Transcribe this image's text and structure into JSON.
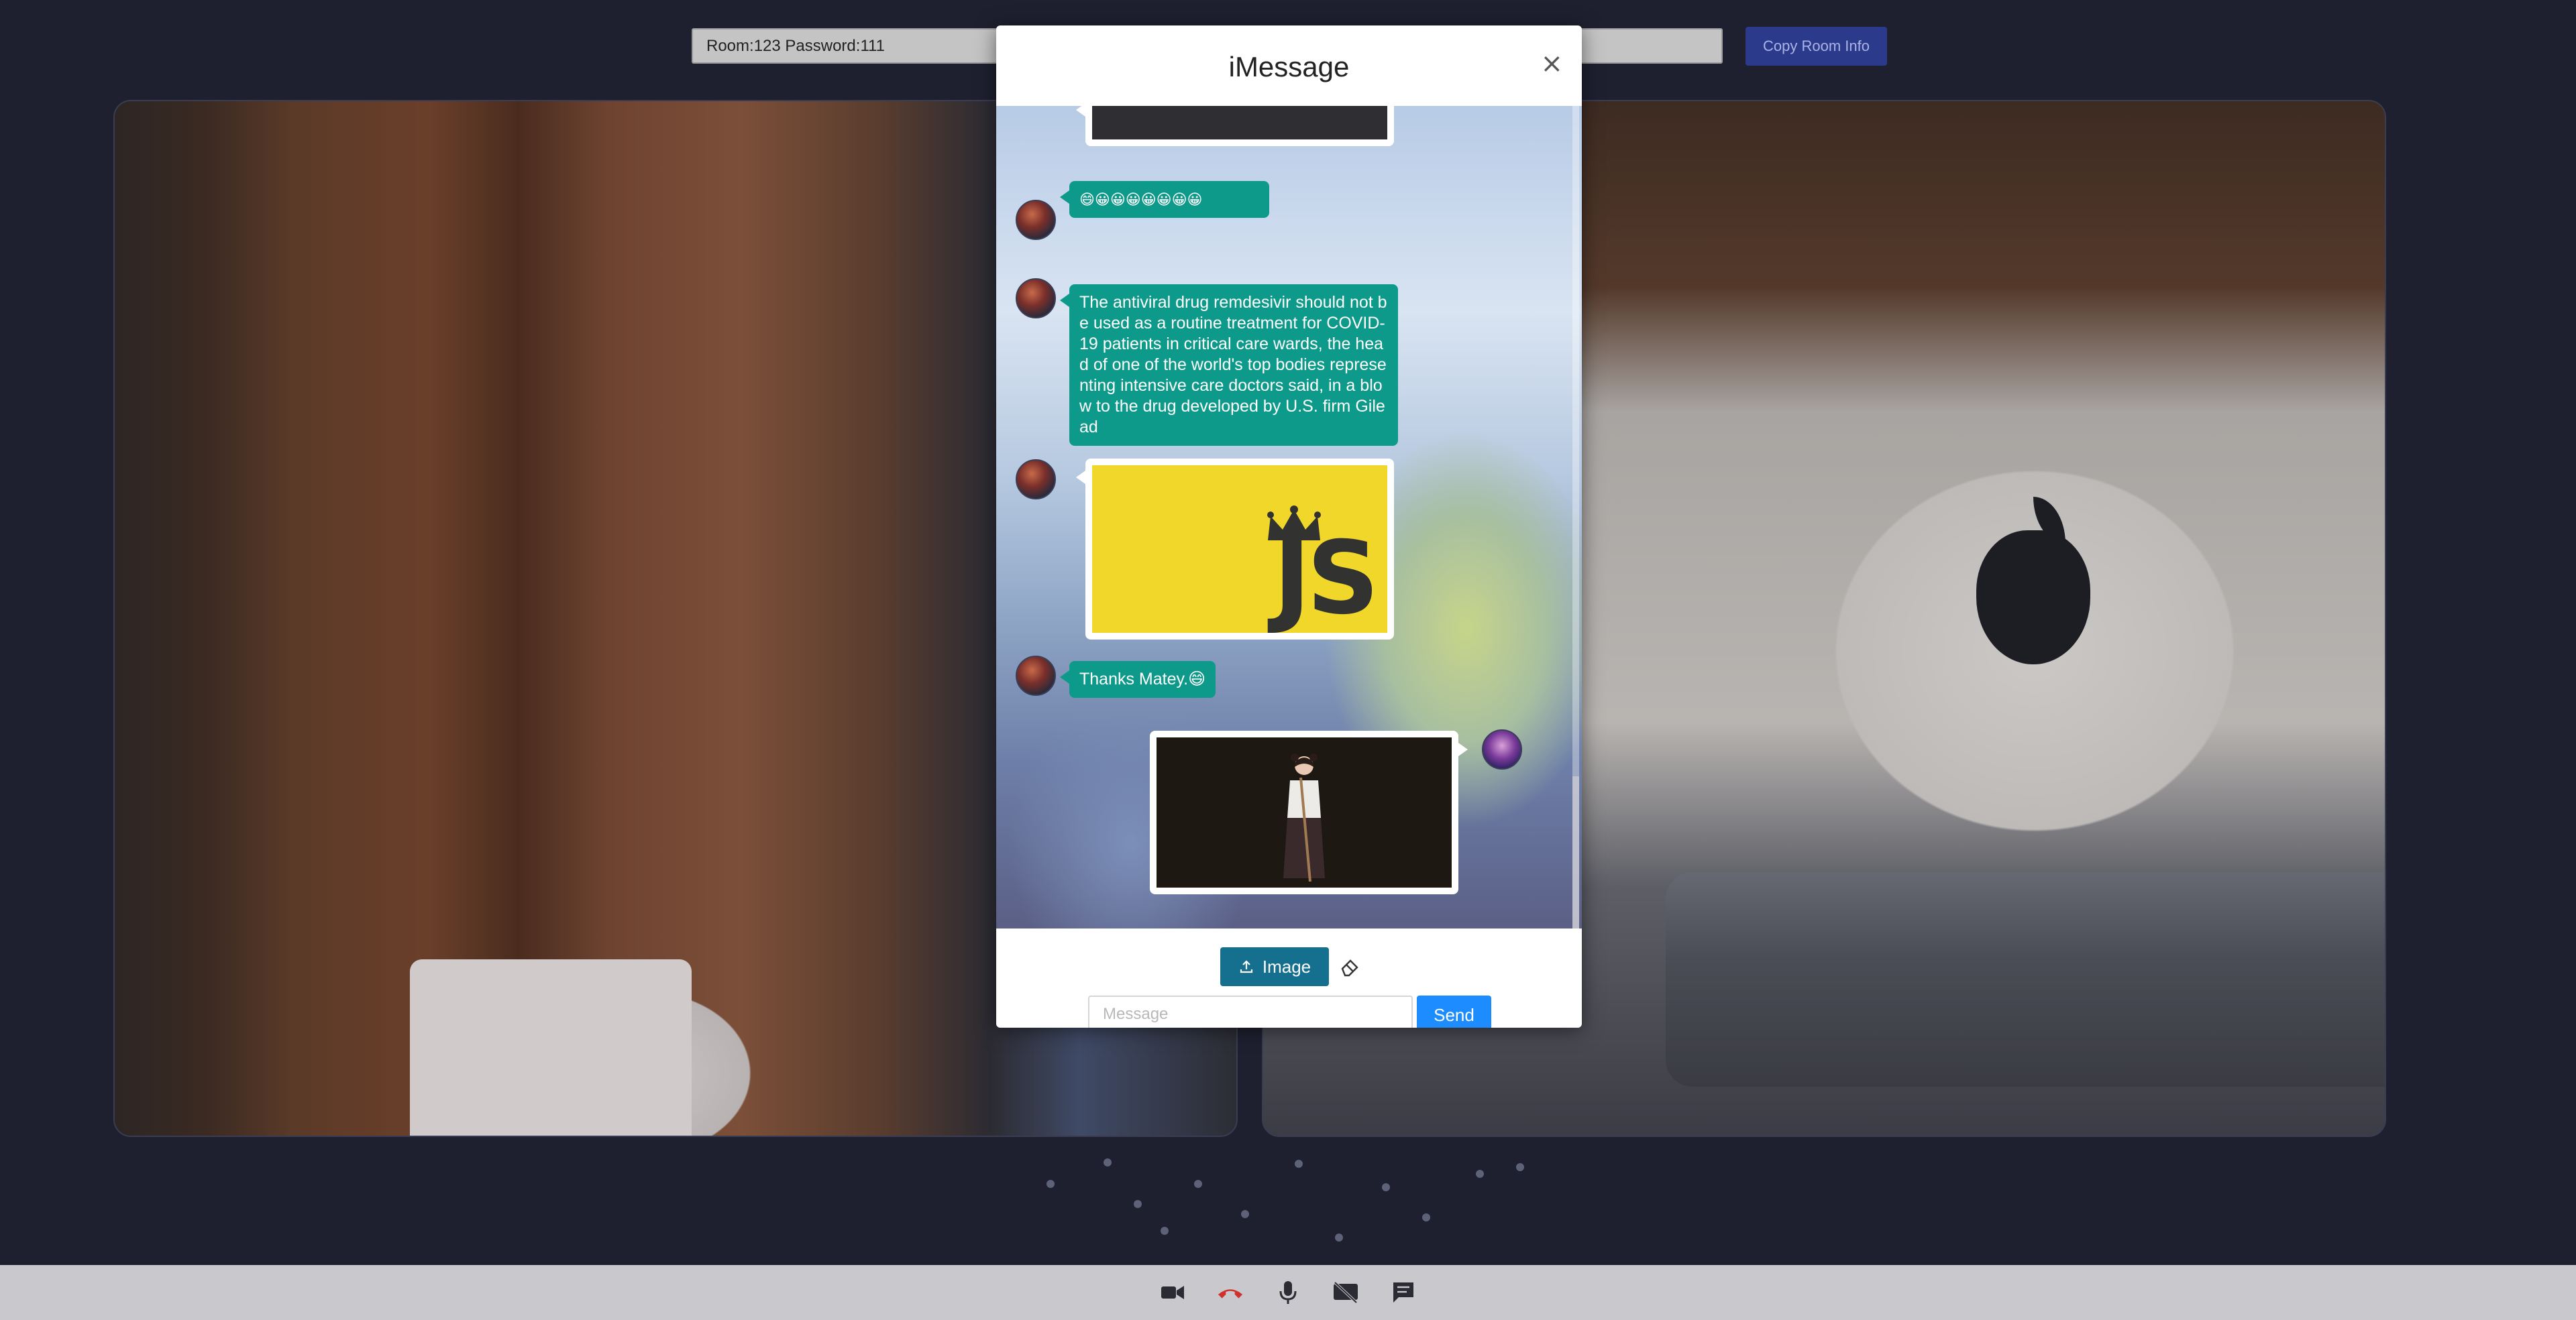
{
  "room_info": {
    "text": "Room:123 Password:111",
    "copy_button": "Copy Room Info"
  },
  "modal": {
    "title": "iMessage",
    "close_glyph": "×"
  },
  "messages": [
    {
      "type": "image",
      "content": "dark image (cropped)",
      "sender": "other"
    },
    {
      "type": "text",
      "text": "😄😀😀😀😀😀😀😀",
      "sender": "other"
    },
    {
      "type": "text",
      "text": "The antiviral drug remdesivir should not be used as a routine treatment for COVID-19 patients in critical care wards, the head of one of the world's top bodies representing intensive care doctors said, in a blow to the drug developed by U.S. firm Gilead",
      "sender": "other"
    },
    {
      "type": "image",
      "content": "JS",
      "sender": "other"
    },
    {
      "type": "text",
      "text": "Thanks Matey.😄",
      "sender": "other"
    },
    {
      "type": "image",
      "content": "character portrait",
      "sender": "me"
    }
  ],
  "composer": {
    "upload_label": "Image",
    "upload_icon": "upload-icon",
    "clear_icon": "eraser-icon",
    "placeholder": "Message",
    "send_label": "Send"
  },
  "toolbar": {
    "icons": [
      "video-camera-icon",
      "hang-up-icon",
      "microphone-icon",
      "screen-share-off-icon",
      "chat-icon"
    ],
    "hangup_color": "#d0312d"
  },
  "colors": {
    "bubble": "#0e9a8a",
    "send": "#1c8cff",
    "upload": "#15708f",
    "background": "#1e2030"
  }
}
